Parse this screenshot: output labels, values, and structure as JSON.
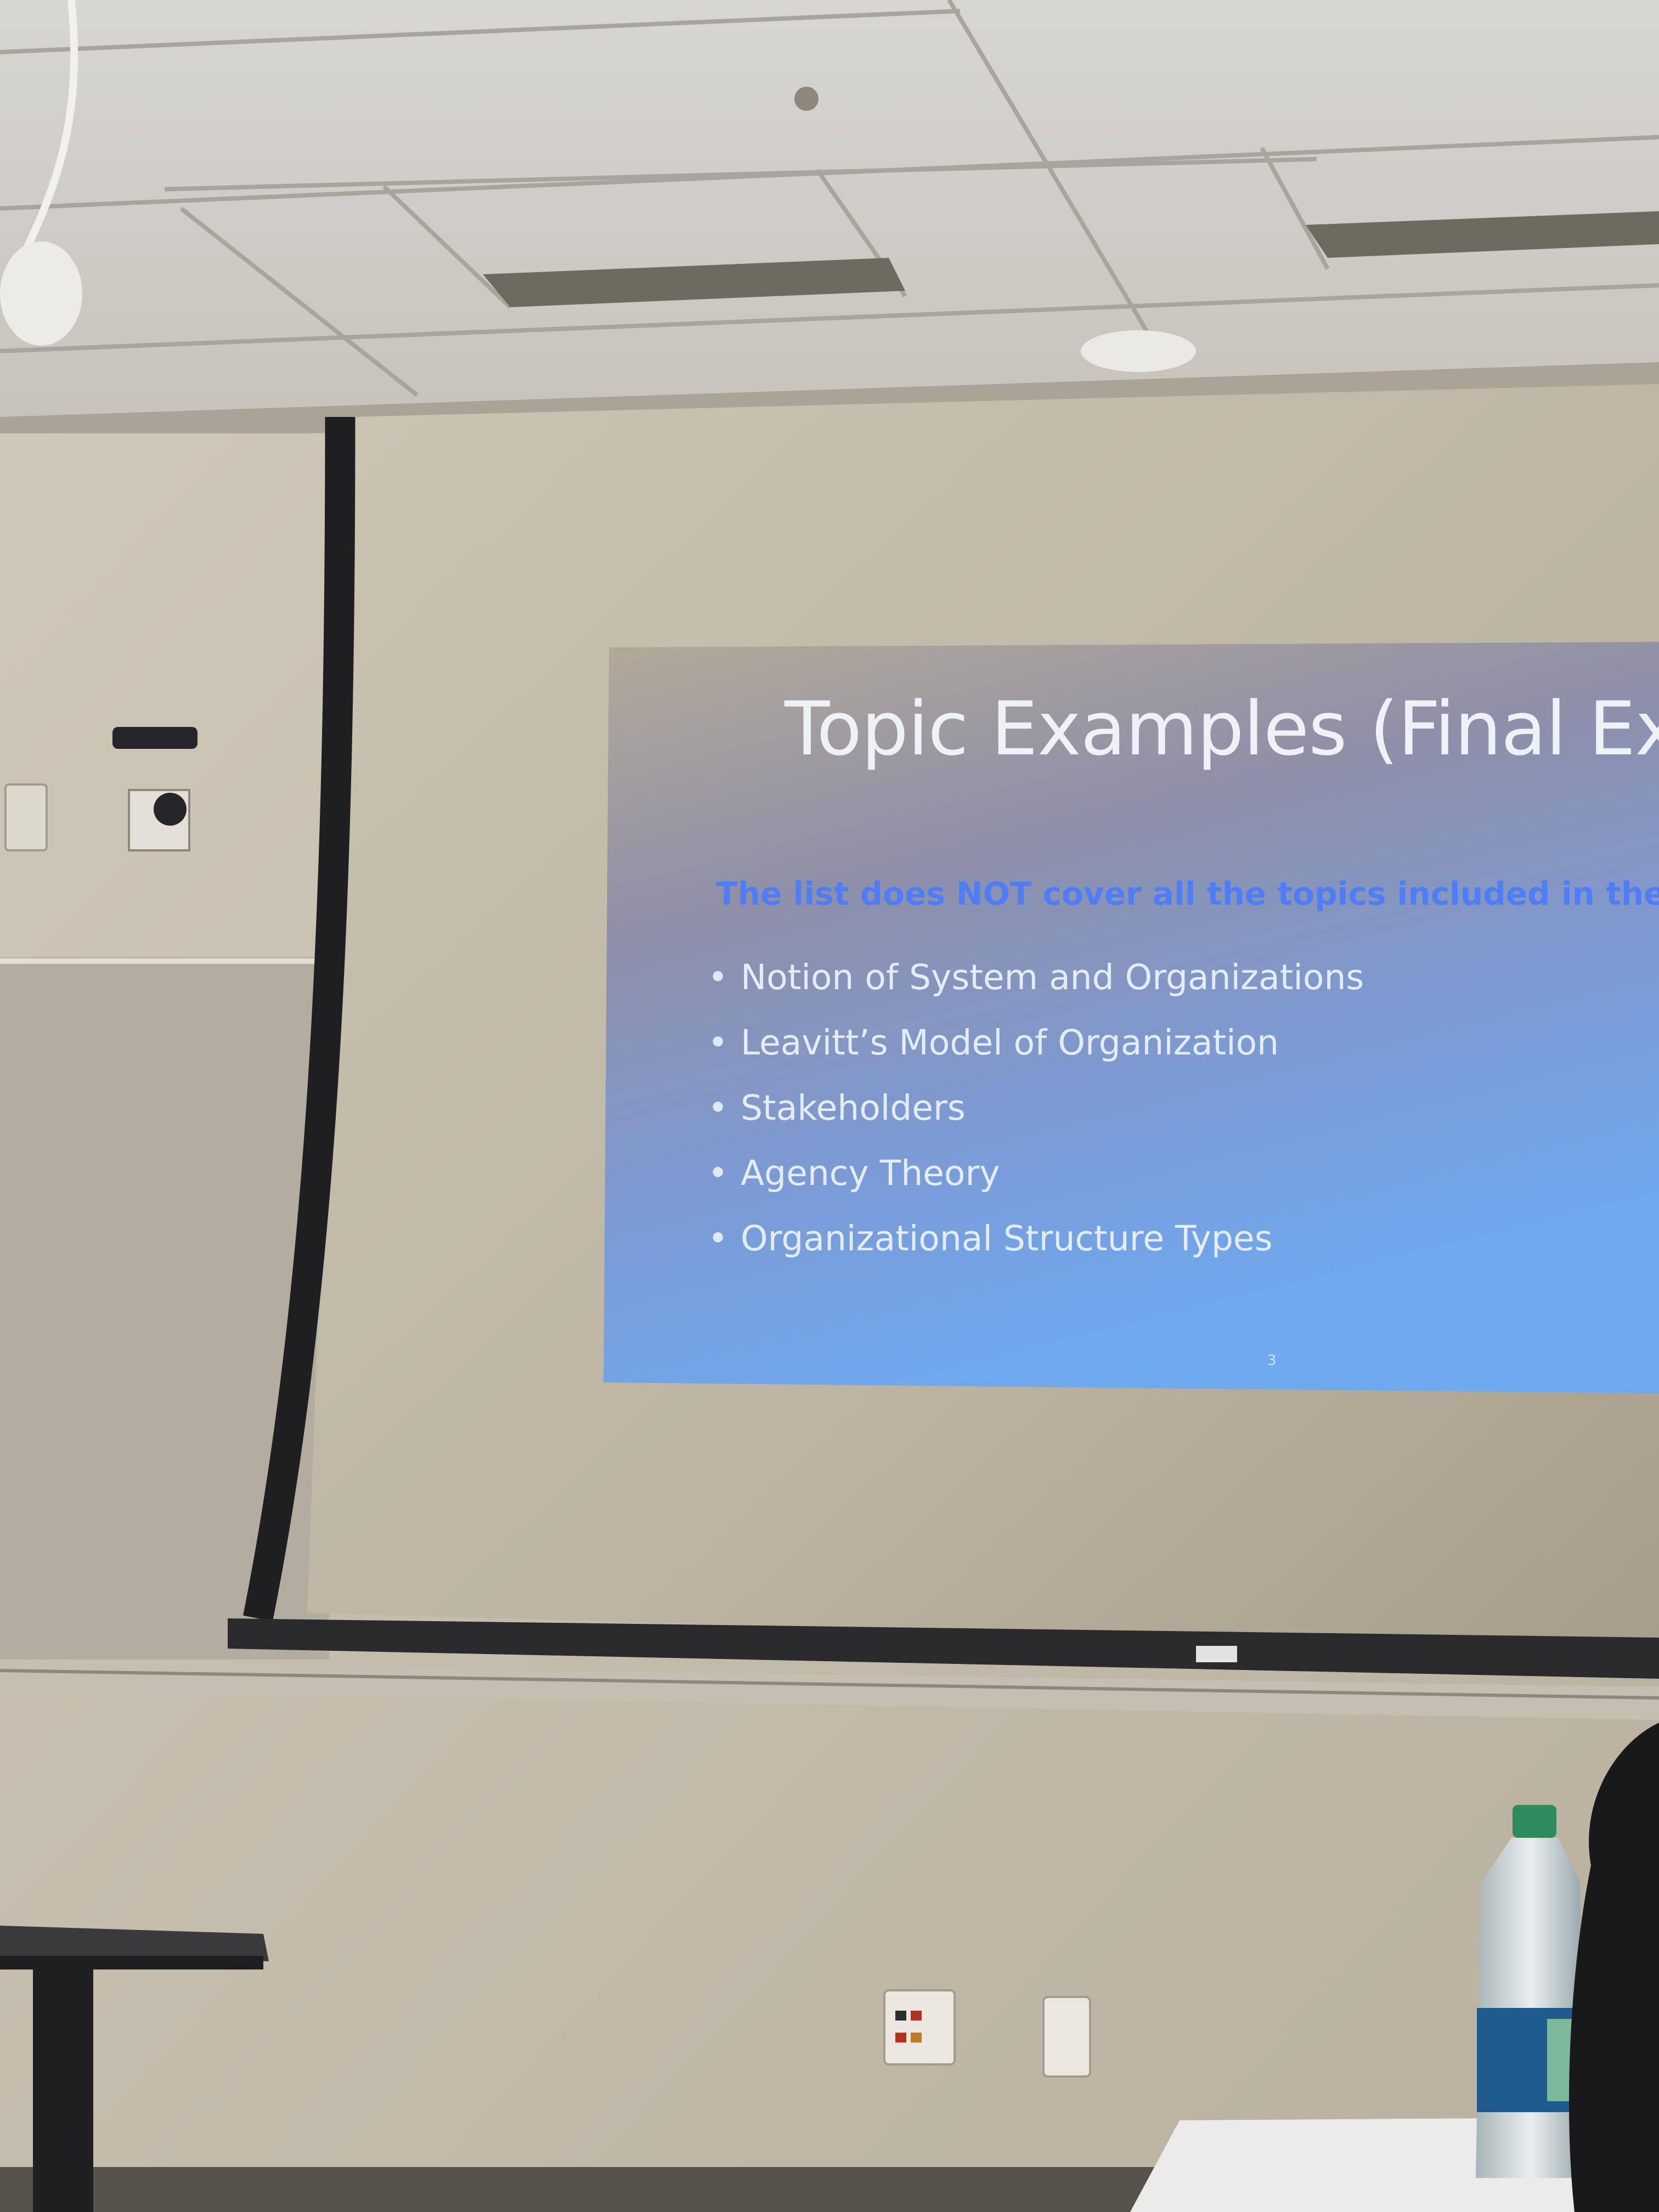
{
  "slide": {
    "title": "Topic Examples (Final Exa",
    "note": "The list does NOT cover all the topics included in the Fi",
    "bullets": [
      "Notion of System and Organizations",
      "Leavitt’s Model of Organization",
      "Stakeholders",
      "Agency Theory",
      "Organizational Structure Types"
    ],
    "page_number": "3"
  },
  "colors": {
    "title": "#eef2f7",
    "note": "#4f7df5",
    "slide_top": "#b7ad9d",
    "slide_bottom": "#6aa6ee"
  }
}
